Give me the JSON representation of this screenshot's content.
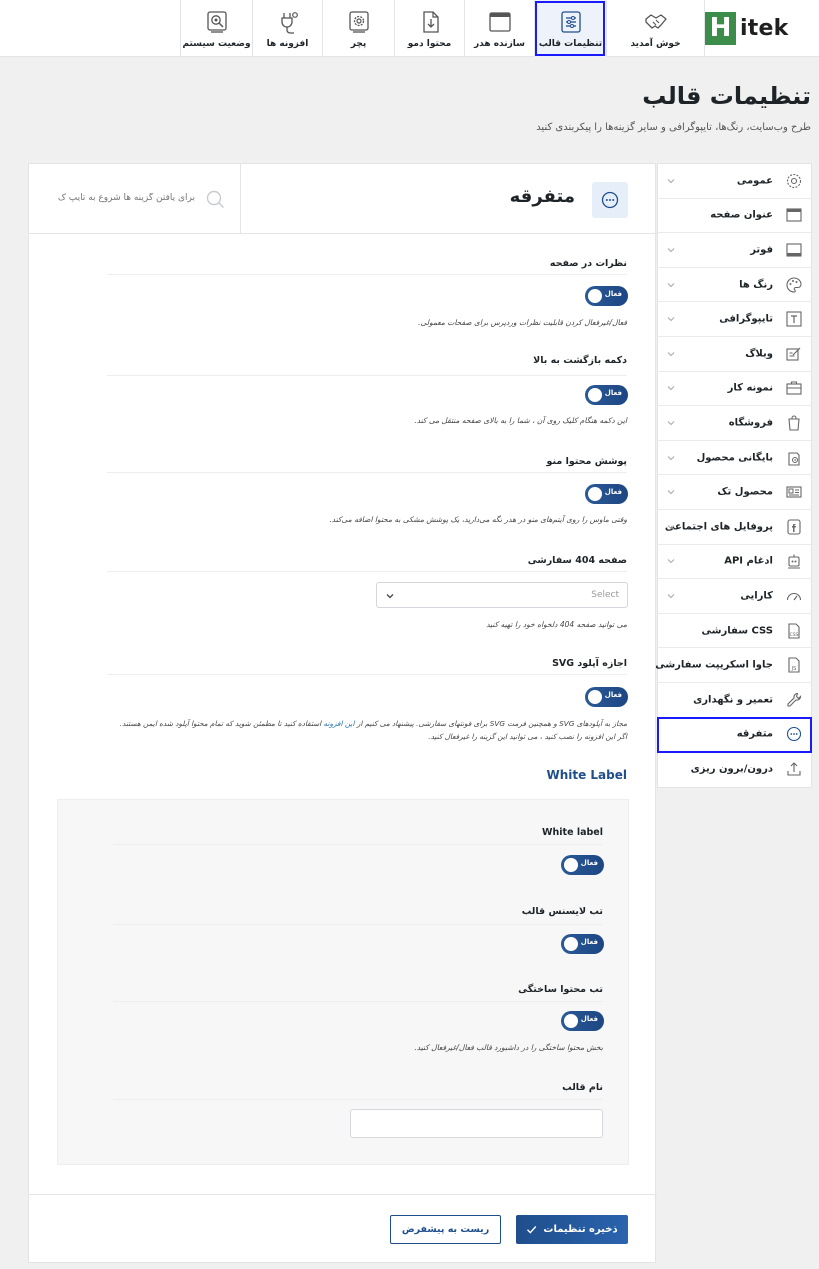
{
  "brand": {
    "mark": "H",
    "name": "itek"
  },
  "nav": [
    {
      "label": "خوش آمدید",
      "icon": "handshake-icon"
    },
    {
      "label": "تنظیمات قالب",
      "icon": "sliders-icon",
      "active": true
    },
    {
      "label": "سازنده هدر",
      "icon": "window-icon"
    },
    {
      "label": "محتوا دمو",
      "icon": "download-doc-icon"
    },
    {
      "label": "پچر",
      "icon": "gear-box-icon"
    },
    {
      "label": "افزونه ها",
      "icon": "plug-icon"
    },
    {
      "label": "وضعیت سیستم",
      "icon": "search-gear-icon"
    }
  ],
  "header": {
    "title": "تنظیمات قالب",
    "subtitle": "طرح وب‌سایت، رنگ‌ها، تایپوگرافی و سایر گزینه‌ها را پیکربندی کنید"
  },
  "sidebar": [
    {
      "label": "عمومی",
      "icon": "gear-icon",
      "chevron": true
    },
    {
      "label": "عنوان صفحه",
      "icon": "title-bar-icon",
      "chevron": false
    },
    {
      "label": "فوتر",
      "icon": "footer-icon",
      "chevron": true
    },
    {
      "label": "رنگ ها",
      "icon": "palette-icon",
      "chevron": true
    },
    {
      "label": "تایپوگرافی",
      "icon": "typography-icon",
      "chevron": true
    },
    {
      "label": "وبلاگ",
      "icon": "edit-icon",
      "chevron": true
    },
    {
      "label": "نمونه کار",
      "icon": "briefcase-icon",
      "chevron": true
    },
    {
      "label": "فروشگاه",
      "icon": "shopping-bag-icon",
      "chevron": true
    },
    {
      "label": "بایگانی محصول",
      "icon": "archive-icon",
      "chevron": true
    },
    {
      "label": "محصول تک",
      "icon": "product-card-icon",
      "chevron": true
    },
    {
      "label": "پروفایل های اجتماعی",
      "icon": "social-icon",
      "chevron": true
    },
    {
      "label": "ادغام API",
      "icon": "api-icon",
      "chevron": true
    },
    {
      "label": "کارایی",
      "icon": "speedometer-icon",
      "chevron": true
    },
    {
      "label": "CSS سفارشی",
      "icon": "css-file-icon",
      "chevron": false
    },
    {
      "label": "جاوا اسکریپت سفارشی",
      "icon": "js-file-icon",
      "chevron": false
    },
    {
      "label": "تعمیر و نگهداری",
      "icon": "wrench-icon",
      "chevron": false
    },
    {
      "label": "متفرقه",
      "icon": "more-circle-icon",
      "chevron": false,
      "active": true
    },
    {
      "label": "درون/برون ریزی",
      "icon": "import-export-icon",
      "chevron": false
    }
  ],
  "panel": {
    "title": "متفرقه",
    "search_placeholder": "برای یافتن گزینه ها شروع به تایپ ک",
    "toggle_on_label": "فعال",
    "fields": {
      "comments": {
        "label": "نظرات در صفحه",
        "desc": "فعال/غیرفعال کردن قابلیت نظرات وردپرس برای صفحات معمولی."
      },
      "back_to_top": {
        "label": "دکمه بازگشت به بالا",
        "desc": "این دکمه هنگام کلیک روی آن ، شما را به بالای صفحه منتقل می کند."
      },
      "menu_overlay": {
        "label": "پوشش محتوا منو",
        "desc": "وقتی ماوس را روی آیتم‌های منو در هدر نگه می‌دارید، یک پوشش مشکی به محتوا اضافه می‌کند."
      },
      "custom_404": {
        "label": "صفحه 404 سفارشی",
        "select_value": "Select",
        "desc": "می توانید صفحه 404 دلخواه خود را تهیه کنید"
      },
      "svg_upload": {
        "label": "اجازه آپلود SVG",
        "desc_line1_a": "مجاز به آپلودهای SVG و همچنین فرمت SVG برای فونتهای سفارشی. پیشنهاد می کنیم از ",
        "desc_link": "این افزونه",
        "desc_line1_b": " استفاده کنید تا مطمئن شوید که تمام محتوا آپلود شده ایمن هستند.",
        "desc_line2": "اگر این افزونه را نصب کنید ، می توانید این گزینه را غیرفعال کنید."
      }
    },
    "white_label": {
      "section_title": "White Label",
      "wl_toggle_label": "White label",
      "license_tab_label": "تب لایسنس قالب",
      "built_content_label": "تب محتوا ساختگی",
      "built_content_desc": "بخش محتوا ساختگی را در داشبورد قالب فعال/غیرفعال کنید.",
      "theme_name_label": "نام قالب",
      "theme_name_value": ""
    },
    "footer": {
      "save_label": "ذخیره تنظیمات",
      "reset_label": "ریست به پیشفرض"
    }
  },
  "colors": {
    "accent": "#1f4e8c",
    "highlight_outline": "#1a1aff",
    "logo_green": "#3c8d4a"
  }
}
